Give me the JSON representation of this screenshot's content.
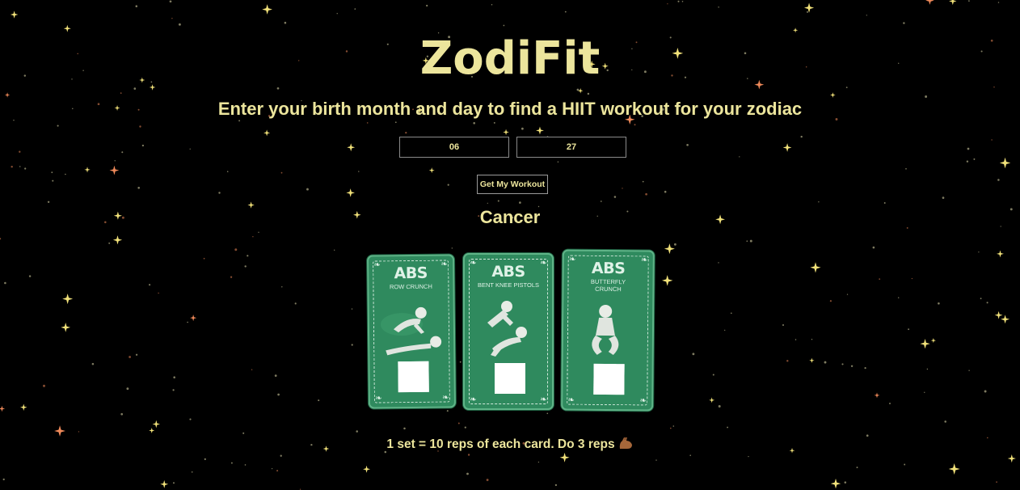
{
  "app": {
    "title": "ZodiFit"
  },
  "prompt": {
    "text": "Enter your birth month and day to find a HIIT workout for your zodiac"
  },
  "form": {
    "month_value": "06",
    "day_value": "27",
    "submit_label": "Get My Workout"
  },
  "result": {
    "sign": "Cancer",
    "cards": [
      {
        "category": "ABS",
        "exercise": "ROW CRUNCH"
      },
      {
        "category": "ABS",
        "exercise": "BENT KNEE PISTOLS"
      },
      {
        "category": "ABS",
        "exercise": "BUTTERFLY CRUNCH"
      }
    ],
    "instructions": "1 set = 10 reps of each card. Do 3 reps",
    "instructions_icon": "flexed-biceps-icon"
  },
  "colors": {
    "background": "#000000",
    "text_accent": "#ece59c",
    "card_green": "#2f8a5e",
    "star_gold": "#f2e27a",
    "star_orange": "#f08a5a"
  }
}
